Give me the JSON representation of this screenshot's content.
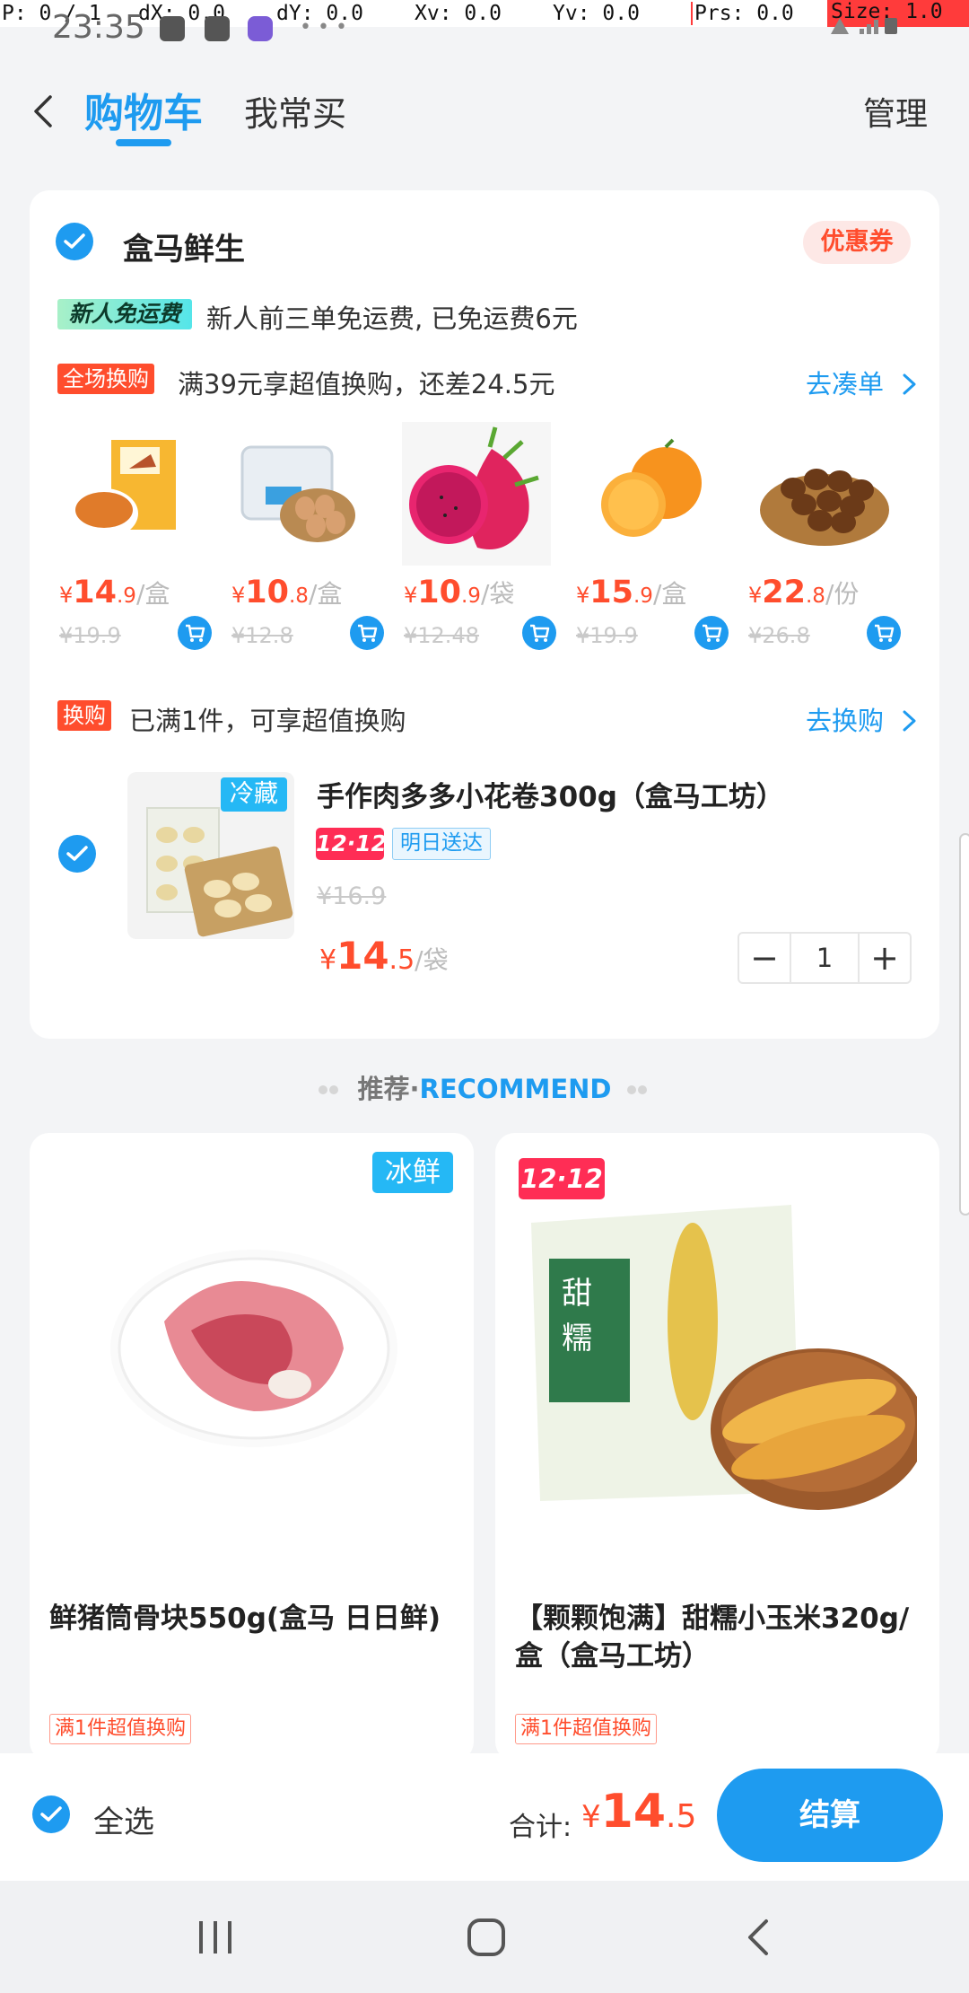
{
  "debug": {
    "p": "P: 0 / 1",
    "dx": "dX: 0.0",
    "dy": "dY: 0.0",
    "xv": "Xv: 0.0",
    "yv": "Yv: 0.0",
    "prs": "Prs: 0.0",
    "size": "Size: 1.0"
  },
  "status": {
    "time": "23:35"
  },
  "header": {
    "tab_cart": "购物车",
    "tab_frequent": "我常买",
    "manage": "管理"
  },
  "store": {
    "name": "盒马鲜生",
    "coupon": "优惠券",
    "new_badge": "新人免运费",
    "new_text": "新人前三单免运费, 已免运费6元",
    "promo_tag": "全场换购",
    "promo_text": "满39元享超值换购，还差24.5元",
    "promo_link": "去凑单",
    "products": [
      {
        "yen": "¥",
        "int": "14",
        "dec": ".9",
        "unit": "/盒",
        "old": "¥19.9",
        "image": "corn-soup"
      },
      {
        "yen": "¥",
        "int": "10",
        "dec": ".8",
        "unit": "/盒",
        "old": "¥12.8",
        "image": "eggs"
      },
      {
        "yen": "¥",
        "int": "10",
        "dec": ".9",
        "unit": "/袋",
        "old": "¥12.48",
        "image": "dragon-fruit"
      },
      {
        "yen": "¥",
        "int": "15",
        "dec": ".9",
        "unit": "/盒",
        "old": "¥19.9",
        "image": "orange"
      },
      {
        "yen": "¥",
        "int": "22",
        "dec": ".8",
        "unit": "/份",
        "old": "¥26.8",
        "image": "chestnuts"
      }
    ],
    "swap_tag": "换购",
    "swap_text": "已满1件，可享超值换购",
    "swap_link": "去换购",
    "item": {
      "cold_tag": "冷藏",
      "name": "手作肉多多小花卷300g（盒马工坊）",
      "tag_1212": "12·12",
      "tag_delivery": "明日送达",
      "old_price": "¥16.9",
      "yen": "¥",
      "int": "14",
      "dec": ".5",
      "unit": "/袋",
      "qty": "1",
      "minus": "−",
      "plus": "+"
    }
  },
  "recommend": {
    "label_cn": "推荐·",
    "label_en": "RECOMMEND",
    "cards": [
      {
        "badge": "冰鲜",
        "title": "鲜猪筒骨块550g(盒马 日日鲜)",
        "tag": "满1件超值换购"
      },
      {
        "badge": "12·12",
        "title": "【颗颗饱满】甜糯小玉米320g/盒（盒马工坊）",
        "tag": "满1件超值换购"
      }
    ]
  },
  "bottom": {
    "select_all": "全选",
    "total_label": "合计:",
    "yen": "¥",
    "int": "14",
    "dec": ".5",
    "checkout": "结算"
  },
  "colors": {
    "accent": "#1e9bf0",
    "price": "#ff4d2d",
    "badge_1212": "#ff2d55"
  }
}
